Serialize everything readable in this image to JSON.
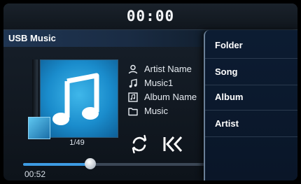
{
  "status_bar": {
    "clock": "00:00"
  },
  "source": {
    "title": "USB Music"
  },
  "track": {
    "counter": "1/49",
    "artist": "Artist Name",
    "title": "Music1",
    "album": "Album Name",
    "folder": "Music",
    "elapsed": "00:52",
    "progress_fraction": 0.37
  },
  "icons": {
    "artist": "person-icon",
    "title": "music-note-icon",
    "album": "album-icon",
    "folder": "folder-icon",
    "repeat": "repeat-icon",
    "previous": "skip-previous-icon"
  },
  "menu": {
    "items": [
      {
        "label": "Folder"
      },
      {
        "label": "Song"
      },
      {
        "label": "Album"
      },
      {
        "label": "Artist"
      }
    ]
  },
  "colors": {
    "accent": "#3d9be3",
    "album_art": "#1a8ccc",
    "panel_bg": "#0c1c32"
  }
}
